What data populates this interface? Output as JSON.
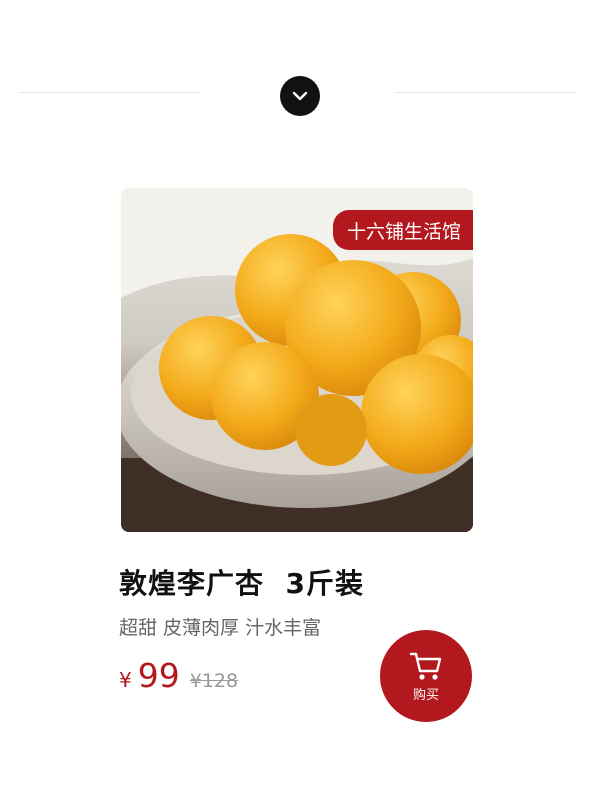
{
  "colors": {
    "accent": "#b3181f",
    "toggle": "#111111",
    "divider": "#e6e6e6",
    "text_primary": "#111111",
    "text_secondary": "#666666",
    "text_muted": "#999999"
  },
  "header": {
    "toggle_icon": "chevron-down-icon"
  },
  "product": {
    "image_description_icon": "apricots-in-bowl-image",
    "shop_tag": "十六铺生活馆",
    "title": "敦煌李广杏  3斤装",
    "subtitle": "超甜 皮薄肉厚 汁水丰富",
    "currency_symbol": "¥",
    "price": "99",
    "original_price": "¥128",
    "buy_label": "购买",
    "buy_icon": "shopping-cart-icon"
  }
}
